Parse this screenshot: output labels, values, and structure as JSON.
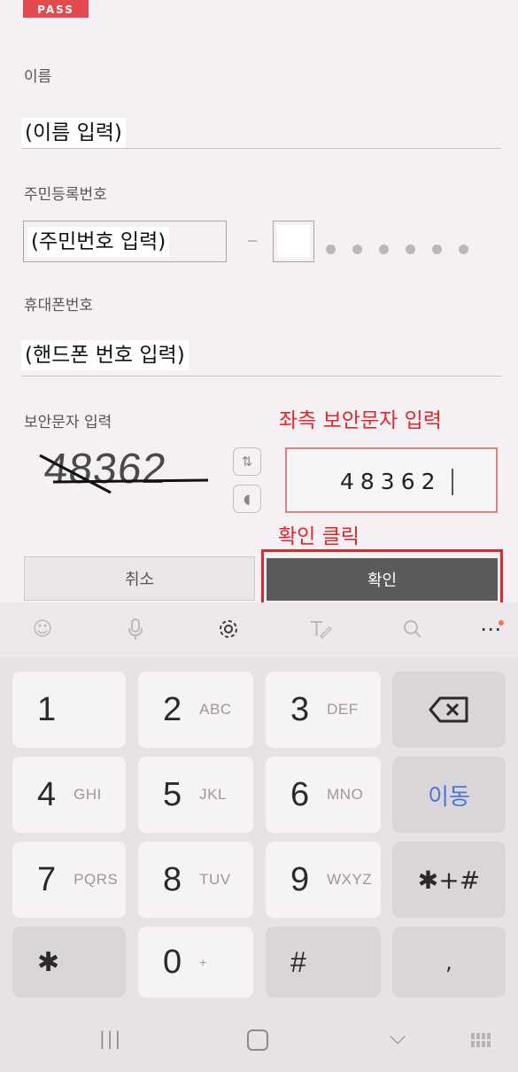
{
  "brand": "PASS",
  "form": {
    "name_label": "이름",
    "name_value": "(이름 입력)",
    "rrn_label": "주민등록번호",
    "rrn_value": "(주민번호 입력)",
    "phone_label": "휴대폰번호",
    "phone_value": "(핸드폰 번호 입력)",
    "captcha_label": "보안문자 입력",
    "captcha_image_text": "48362",
    "captcha_input_value": "48362",
    "annotation_captcha": "좌측 보안문자 입력",
    "annotation_confirm": "확인 클릭",
    "cancel_label": "취소",
    "confirm_label": "확인"
  },
  "toolbar": {
    "items": [
      "emoji-icon",
      "mic-icon",
      "settings-icon",
      "handwriting-icon",
      "search-icon",
      "more-icon"
    ],
    "more_label": "⋯"
  },
  "keyboard": {
    "rows": [
      [
        {
          "num": "1",
          "letters": ""
        },
        {
          "num": "2",
          "letters": "ABC"
        },
        {
          "num": "3",
          "letters": "DEF"
        }
      ],
      [
        {
          "num": "4",
          "letters": "GHI"
        },
        {
          "num": "5",
          "letters": "JKL"
        },
        {
          "num": "6",
          "letters": "MNO"
        }
      ],
      [
        {
          "num": "7",
          "letters": "PQRS"
        },
        {
          "num": "8",
          "letters": "TUV"
        },
        {
          "num": "9",
          "letters": "WXYZ"
        }
      ],
      [
        {
          "num": "✱",
          "letters": ""
        },
        {
          "num": "0",
          "letters": "+"
        },
        {
          "num": "#",
          "letters": ""
        }
      ]
    ],
    "move_label": "이동",
    "symbols_label": "✱+#",
    "comma_label": ",",
    "accent_color": "#4a78d8",
    "annotation_color": "#e2262a"
  },
  "navbar": {
    "recent_label": "|||",
    "back_label": "⌵"
  }
}
